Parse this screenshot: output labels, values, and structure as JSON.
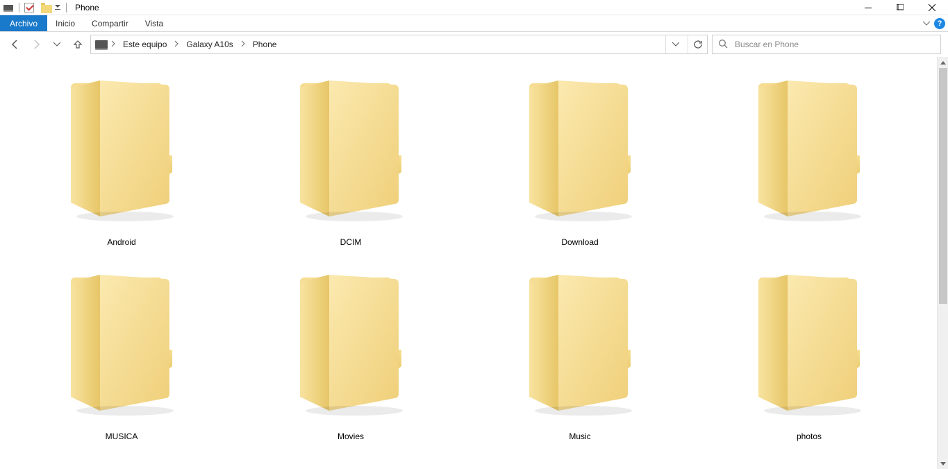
{
  "window": {
    "title": "Phone"
  },
  "ribbon": {
    "file": "Archivo",
    "tabs": [
      "Inicio",
      "Compartir",
      "Vista"
    ]
  },
  "breadcrumbs": [
    "Este equipo",
    "Galaxy A10s",
    "Phone"
  ],
  "search": {
    "placeholder": "Buscar en Phone"
  },
  "folders": [
    {
      "name": "Android"
    },
    {
      "name": "DCIM"
    },
    {
      "name": "Download"
    },
    {
      "name": ""
    },
    {
      "name": "MUSICA"
    },
    {
      "name": "Movies"
    },
    {
      "name": "Music"
    },
    {
      "name": "photos"
    }
  ]
}
